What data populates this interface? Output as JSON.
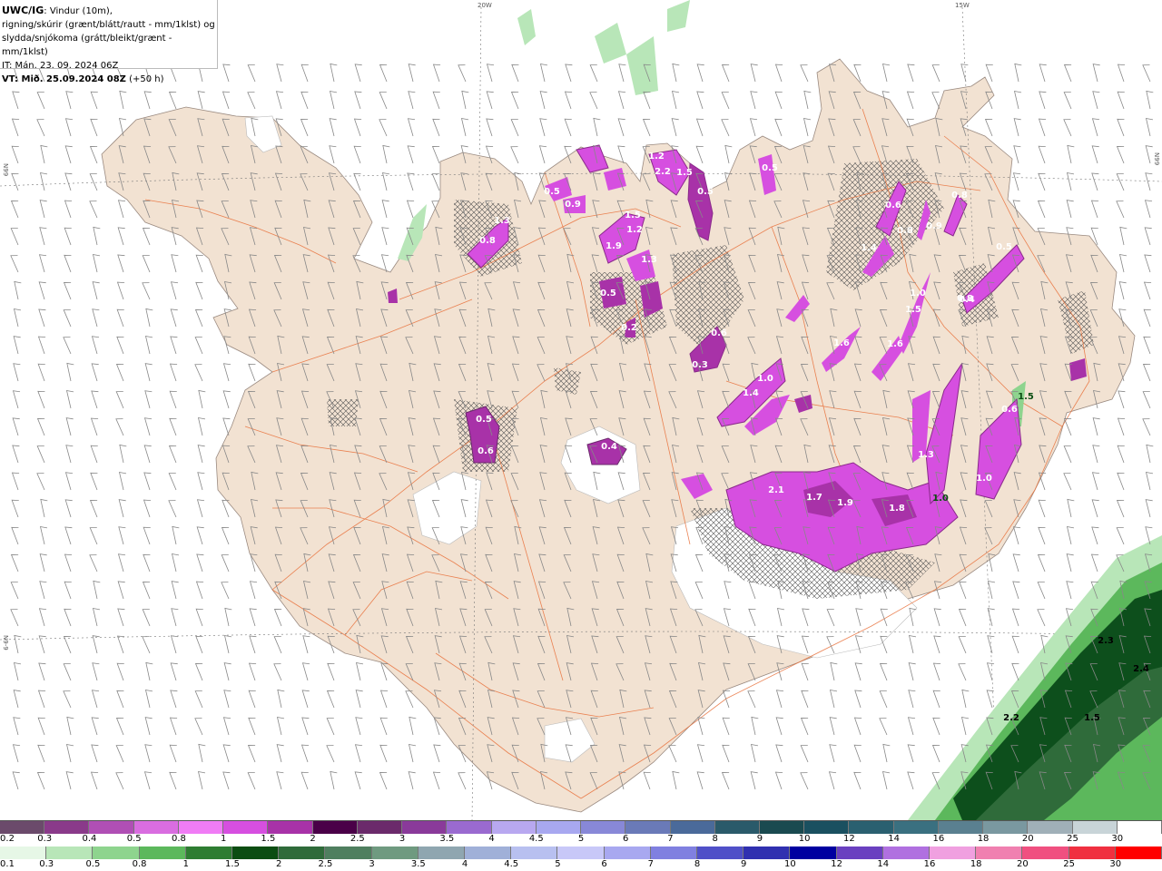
{
  "header": {
    "model": "UWC/IG",
    "line1_rest": ": Vindur (10m),",
    "line2": "rigning/skúrir (grænt/blátt/rautt - mm/1klst) og",
    "line3": "slydda/snjókoma (grátt/bleikt/grænt - mm/1klst)",
    "line4": "IT: Mán. 23. 09. 2024 06Z",
    "line5_bold": "VT: Mið. 25.09.2024 08Z",
    "line5_rest": " (+50 h)"
  },
  "graticule": {
    "lon_20w": "20W",
    "lon_15w": "15W",
    "lat_66n_left": "N99",
    "lat_66n_right": "N99",
    "lat_64n_left": "N9-9"
  },
  "colors": {
    "land": "#f2e2d2",
    "glacier": "#ffffff",
    "sea": "#ffffff",
    "roads": "#e8703a",
    "snow_core": "#d64fe0",
    "snow_light": "#ef7ef5",
    "snow_dark": "#8a2a8a",
    "rain_dark": "#0d4f1c",
    "rain_mid": "#3f8f4f",
    "rain_light": "#9fdba8"
  },
  "precip_labels": [
    {
      "text": "1.3",
      "kind": "snow"
    },
    {
      "text": "0.8",
      "kind": "snow"
    },
    {
      "text": "0.5",
      "kind": "snow"
    },
    {
      "text": "0.9",
      "kind": "snow"
    },
    {
      "text": "1.5",
      "kind": "snow"
    },
    {
      "text": "1.2",
      "kind": "snow"
    },
    {
      "text": "1.9",
      "kind": "snow"
    },
    {
      "text": "1.3",
      "kind": "snow"
    },
    {
      "text": "0.5",
      "kind": "snow"
    },
    {
      "text": "0.2",
      "kind": "snow"
    },
    {
      "text": "1.2",
      "kind": "snow"
    },
    {
      "text": "2.2",
      "kind": "snow"
    },
    {
      "text": "0.5",
      "kind": "snow"
    },
    {
      "text": "1.5",
      "kind": "snow"
    },
    {
      "text": "0.5",
      "kind": "snow"
    },
    {
      "text": "0.6",
      "kind": "snow"
    },
    {
      "text": "1.4",
      "kind": "snow"
    },
    {
      "text": "0.8",
      "kind": "snow"
    },
    {
      "text": "0.9",
      "kind": "snow"
    },
    {
      "text": "0.8",
      "kind": "snow"
    },
    {
      "text": "0.5",
      "kind": "snow"
    },
    {
      "text": "0.4",
      "kind": "snow"
    },
    {
      "text": "1.0",
      "kind": "snow"
    },
    {
      "text": "1.5",
      "kind": "snow"
    },
    {
      "text": "1.6",
      "kind": "snow"
    },
    {
      "text": "0.3",
      "kind": "snow"
    },
    {
      "text": "1.6",
      "kind": "snow"
    },
    {
      "text": "0.6",
      "kind": "snow"
    },
    {
      "text": "1.0",
      "kind": "snow"
    },
    {
      "text": "1.4",
      "kind": "snow"
    },
    {
      "text": "1.5",
      "kind": "rain"
    },
    {
      "text": "0.5",
      "kind": "snow"
    },
    {
      "text": "0.6",
      "kind": "snow"
    },
    {
      "text": "0.4",
      "kind": "snow"
    },
    {
      "text": "1.3",
      "kind": "snow"
    },
    {
      "text": "0.6",
      "kind": "snow"
    },
    {
      "text": "1.0",
      "kind": "snow"
    },
    {
      "text": "0.8",
      "kind": "snow"
    },
    {
      "text": "2.1",
      "kind": "snow"
    },
    {
      "text": "1.7",
      "kind": "snow"
    },
    {
      "text": "1.9",
      "kind": "snow"
    },
    {
      "text": "1.8",
      "kind": "snow"
    },
    {
      "text": "1.0",
      "kind": "rain"
    },
    {
      "text": "2.3",
      "kind": "rain"
    },
    {
      "text": "2.4",
      "kind": "rain"
    },
    {
      "text": "2.2",
      "kind": "rain"
    },
    {
      "text": "1.5",
      "kind": "rain"
    }
  ],
  "legend_snow": {
    "labels": [
      "0.2",
      "0.3",
      "0.4",
      "0.5",
      "0.8",
      "1",
      "1.5",
      "2",
      "2.5",
      "3",
      "3.5",
      "4",
      "4.5",
      "5",
      "6",
      "7",
      "8",
      "9",
      "10",
      "12",
      "14",
      "16",
      "18",
      "20",
      "25",
      "30"
    ],
    "colors": [
      "#6b4a6b",
      "#8a3a8a",
      "#b04fb5",
      "#d96de0",
      "#f07cf5",
      "#d64fe0",
      "#a832a8",
      "#4a0048",
      "#6b2a6b",
      "#8a3a9a",
      "#9a6ad0",
      "#b8a8f0",
      "#a8a8f0",
      "#8888d8",
      "#6a7ab8",
      "#4a6a9a",
      "#2a5a6a",
      "#1a4a50",
      "#1a5060",
      "#2a6070",
      "#3a7080",
      "#5a8090",
      "#7a98a0",
      "#a0b0b8",
      "#c8d4d8",
      "#ffffff"
    ]
  },
  "legend_rain": {
    "labels": [
      "0.1",
      "0.3",
      "0.5",
      "0.8",
      "1",
      "1.5",
      "2",
      "2.5",
      "3",
      "3.5",
      "4",
      "4.5",
      "5",
      "6",
      "7",
      "8",
      "9",
      "10",
      "12",
      "14",
      "16",
      "18",
      "20",
      "25",
      "30"
    ],
    "colors": [
      "#e6f7e6",
      "#b8e6b8",
      "#8ed48e",
      "#5cb85c",
      "#2e7d32",
      "#0b4d12",
      "#2f6b3a",
      "#4f7f5f",
      "#6f9a80",
      "#8fa6b0",
      "#a0b0d8",
      "#b8c0f0",
      "#c8c8f8",
      "#a8a8f0",
      "#8080e0",
      "#5050c8",
      "#3030b0",
      "#0000a0",
      "#6a40c0",
      "#b070e0",
      "#f0a0e0",
      "#f080b0",
      "#f05080",
      "#f03040",
      "#ff0000"
    ]
  }
}
